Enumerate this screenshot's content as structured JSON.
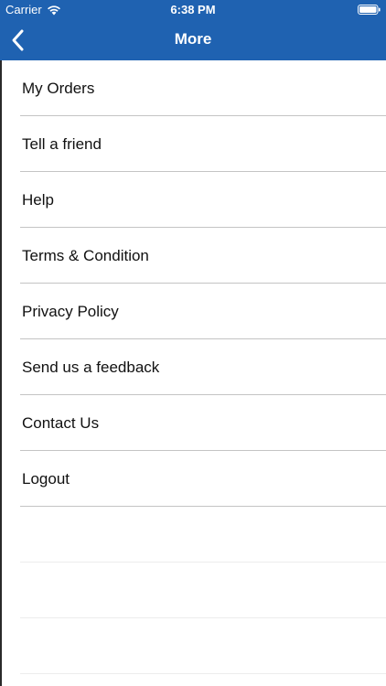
{
  "status_bar": {
    "carrier": "Carrier",
    "time": "6:38 PM",
    "wifi_icon": "wifi-icon",
    "battery_icon": "battery-icon"
  },
  "nav": {
    "title": "More",
    "back_icon": "chevron-left-icon"
  },
  "menu": {
    "items": [
      {
        "label": "My Orders"
      },
      {
        "label": "Tell a friend"
      },
      {
        "label": "Help"
      },
      {
        "label": "Terms & Condition"
      },
      {
        "label": "Privacy Policy"
      },
      {
        "label": "Send us a feedback"
      },
      {
        "label": "Contact Us"
      },
      {
        "label": "Logout"
      }
    ]
  },
  "colors": {
    "nav_background": "#1f62b1",
    "text": "#111111",
    "divider": "#c4c4c4"
  }
}
